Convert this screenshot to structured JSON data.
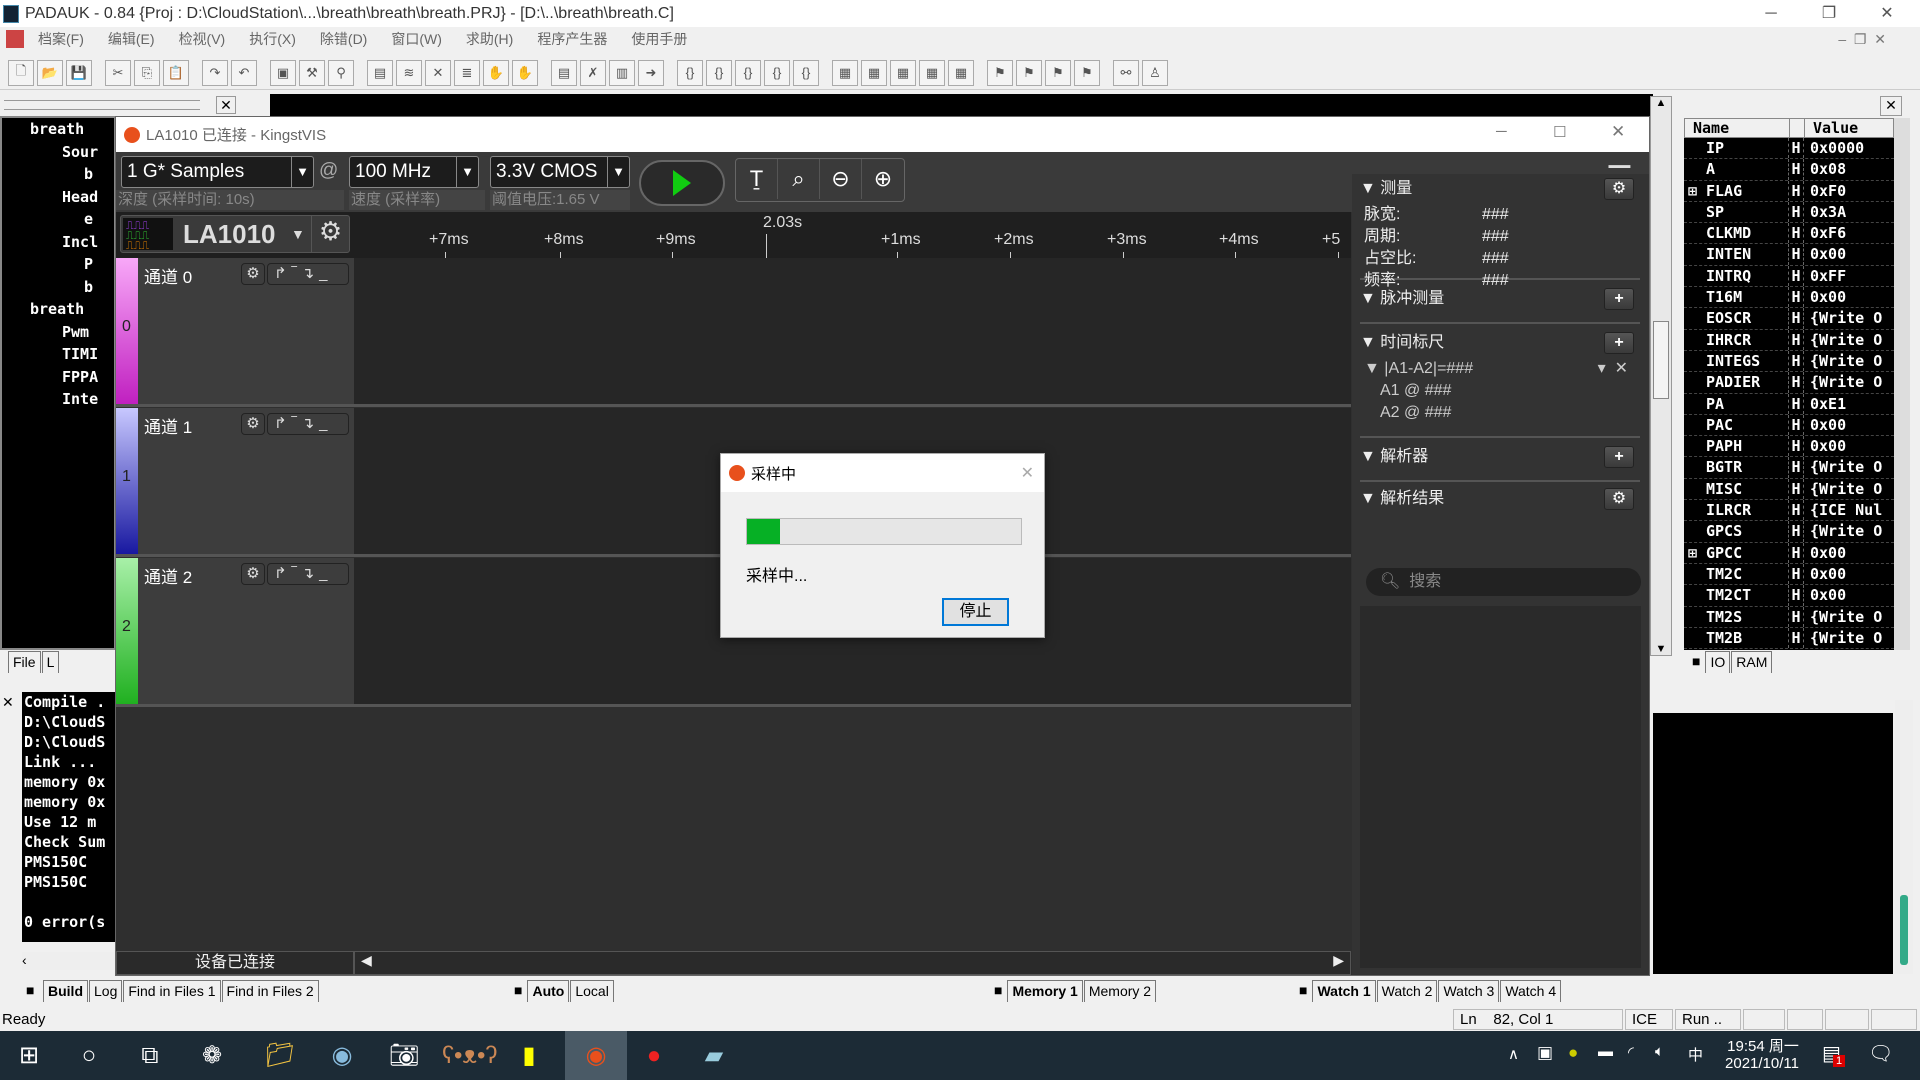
{
  "ide": {
    "title": "PADAUK - 0.84 {Proj : D:\\CloudStation\\...\\breath\\breath\\breath.PRJ} - [D:\\..\\breath\\breath.C]",
    "menu": [
      "档案(F)",
      "编辑(E)",
      "检视(V)",
      "执行(X)",
      "除错(D)",
      "窗口(W)",
      "求助(H)",
      "程序产生器",
      "使用手册"
    ],
    "tree": [
      "breath",
      "Sour",
      "b",
      "Head",
      "e",
      "Incl",
      "P",
      "b",
      "breath",
      "Pwm",
      "TIMI",
      "FPPA",
      "Inte"
    ],
    "tree_tabs": [
      "File",
      "L"
    ],
    "output_lines": [
      "Compile .",
      "D:\\CloudS",
      "D:\\CloudS",
      "Link ...",
      "memory 0x",
      "memory 0x",
      "Use  12 m",
      "Check Sum",
      "PMS150C",
      "PMS150C",
      "",
      "0 error(s"
    ],
    "output_tabs": [
      "Build",
      "Log",
      "Find in Files 1",
      "Find in Files 2"
    ],
    "mid_tabs": [
      "Auto",
      "Local"
    ],
    "memory_tabs": [
      "Memory 1",
      "Memory 2"
    ],
    "watch_tabs": [
      "Watch 1",
      "Watch 2",
      "Watch 3",
      "Watch 4"
    ],
    "reg_tabs": [
      "IO",
      "RAM"
    ],
    "registers": {
      "headers": [
        "Name",
        "",
        "Value"
      ],
      "rows": [
        [
          "IP",
          "H",
          "0x0000"
        ],
        [
          "A",
          "H",
          "0x08"
        ],
        [
          "FLAG",
          "H",
          "0xF0"
        ],
        [
          "SP",
          "H",
          "0x3A"
        ],
        [
          "CLKMD",
          "H",
          "0xF6"
        ],
        [
          "INTEN",
          "H",
          "0x00"
        ],
        [
          "INTRQ",
          "H",
          "0xFF"
        ],
        [
          "T16M",
          "H",
          "0x00"
        ],
        [
          "EOSCR",
          "H",
          "{Write O"
        ],
        [
          "IHRCR",
          "H",
          "{Write O"
        ],
        [
          "INTEGS",
          "H",
          "{Write O"
        ],
        [
          "PADIER",
          "H",
          "{Write O"
        ],
        [
          "PA",
          "H",
          "0xE1"
        ],
        [
          "PAC",
          "H",
          "0x00"
        ],
        [
          "PAPH",
          "H",
          "0x00"
        ],
        [
          "BGTR",
          "H",
          "{Write O"
        ],
        [
          "MISC",
          "H",
          "{Write O"
        ],
        [
          "ILRCR",
          "H",
          "{ICE Nul"
        ],
        [
          "GPCS",
          "H",
          "{Write O"
        ],
        [
          "GPCC",
          "H",
          "0x00"
        ],
        [
          "TM2C",
          "H",
          "0x00"
        ],
        [
          "TM2CT",
          "H",
          "0x00"
        ],
        [
          "TM2S",
          "H",
          "{Write O"
        ],
        [
          "TM2B",
          "H",
          "{Write O"
        ]
      ]
    },
    "status": {
      "ready": "Ready",
      "ln": "Ln",
      "pos": "82, Col 1",
      "ice": "ICE",
      "run": "Run .."
    }
  },
  "kingst": {
    "title": "LA1010 已连接 - KingstVIS",
    "depth": "1 G* Samples",
    "depth_label": "深度 (采样时间: 10s)",
    "at": "@",
    "rate": "100 MHz",
    "rate_label": "速度 (采样率)",
    "threshold": "3.3V CMOS",
    "threshold_label": "阈值电压:1.65 V",
    "device": "LA1010",
    "cursor_time": "2.03s",
    "ticks": [
      "+7ms",
      "+8ms",
      "+9ms",
      "+1ms",
      "+2ms",
      "+3ms",
      "+4ms",
      "+5"
    ],
    "channels": [
      {
        "name": "通道 0",
        "num": "0",
        "color": "#d030d0"
      },
      {
        "name": "通道 1",
        "num": "1",
        "color": "#3030c0"
      },
      {
        "name": "通道 2",
        "num": "2",
        "color": "#30c030"
      }
    ],
    "status": "设备已连接",
    "panel": {
      "measure": "测量",
      "measure_rows": [
        [
          "脉宽:",
          "###"
        ],
        [
          "周期:",
          "###"
        ],
        [
          "占空比:",
          "###"
        ],
        [
          "频率:",
          "###"
        ]
      ],
      "pulse": "脉冲测量",
      "ruler": "时间标尺",
      "ruler_expr": "|A1-A2|=###",
      "a1": "A1 @ ###",
      "a2": "A2 @ ###",
      "decoder": "解析器",
      "results": "解析结果",
      "search_placeholder": "搜索"
    }
  },
  "dialog": {
    "title": "采样中",
    "message": "采样中...",
    "stop": "停止",
    "progress_percent": 12
  },
  "taskbar": {
    "time": "19:54 周一",
    "date": "2021/10/11",
    "ime": "中",
    "notif_count": "1"
  }
}
